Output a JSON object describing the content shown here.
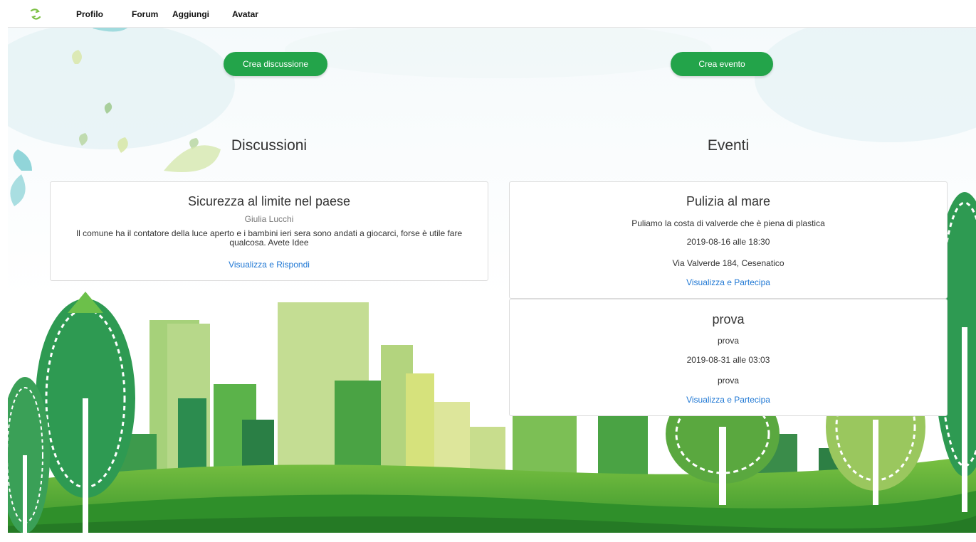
{
  "nav": {
    "logo_icon": "leaf-swirl-logo-icon",
    "items": [
      {
        "label": "Profilo"
      },
      {
        "label": "Forum"
      },
      {
        "label": "Aggiungi"
      },
      {
        "label": "Avatar"
      }
    ]
  },
  "actions": {
    "create_discussion": "Crea discussione",
    "create_event": "Crea evento"
  },
  "discussions": {
    "heading": "Discussioni",
    "items": [
      {
        "title": "Sicurezza al limite nel paese",
        "author": "Giulia Lucchi",
        "body": "Il comune ha il contatore della luce aperto e i bambini ieri sera sono andati a giocarci, forse è utile fare qualcosa. Avete Idee",
        "link": "Visualizza e Rispondi"
      }
    ]
  },
  "events": {
    "heading": "Eventi",
    "items": [
      {
        "title": "Pulizia al mare",
        "description": "Puliamo la costa di valverde che è piena di plastica",
        "datetime": "2019-08-16 alle 18:30",
        "location": "Via Valverde 184, Cesenatico",
        "link": "Visualizza e Partecipa"
      },
      {
        "title": "prova",
        "description": "prova",
        "datetime": "2019-08-31 alle 03:03",
        "location": "prova",
        "link": "Visualizza e Partecipa"
      }
    ]
  },
  "colors": {
    "button_green": "#23a44a",
    "link_blue": "#2078d4",
    "logo_green": "#7bc043"
  }
}
